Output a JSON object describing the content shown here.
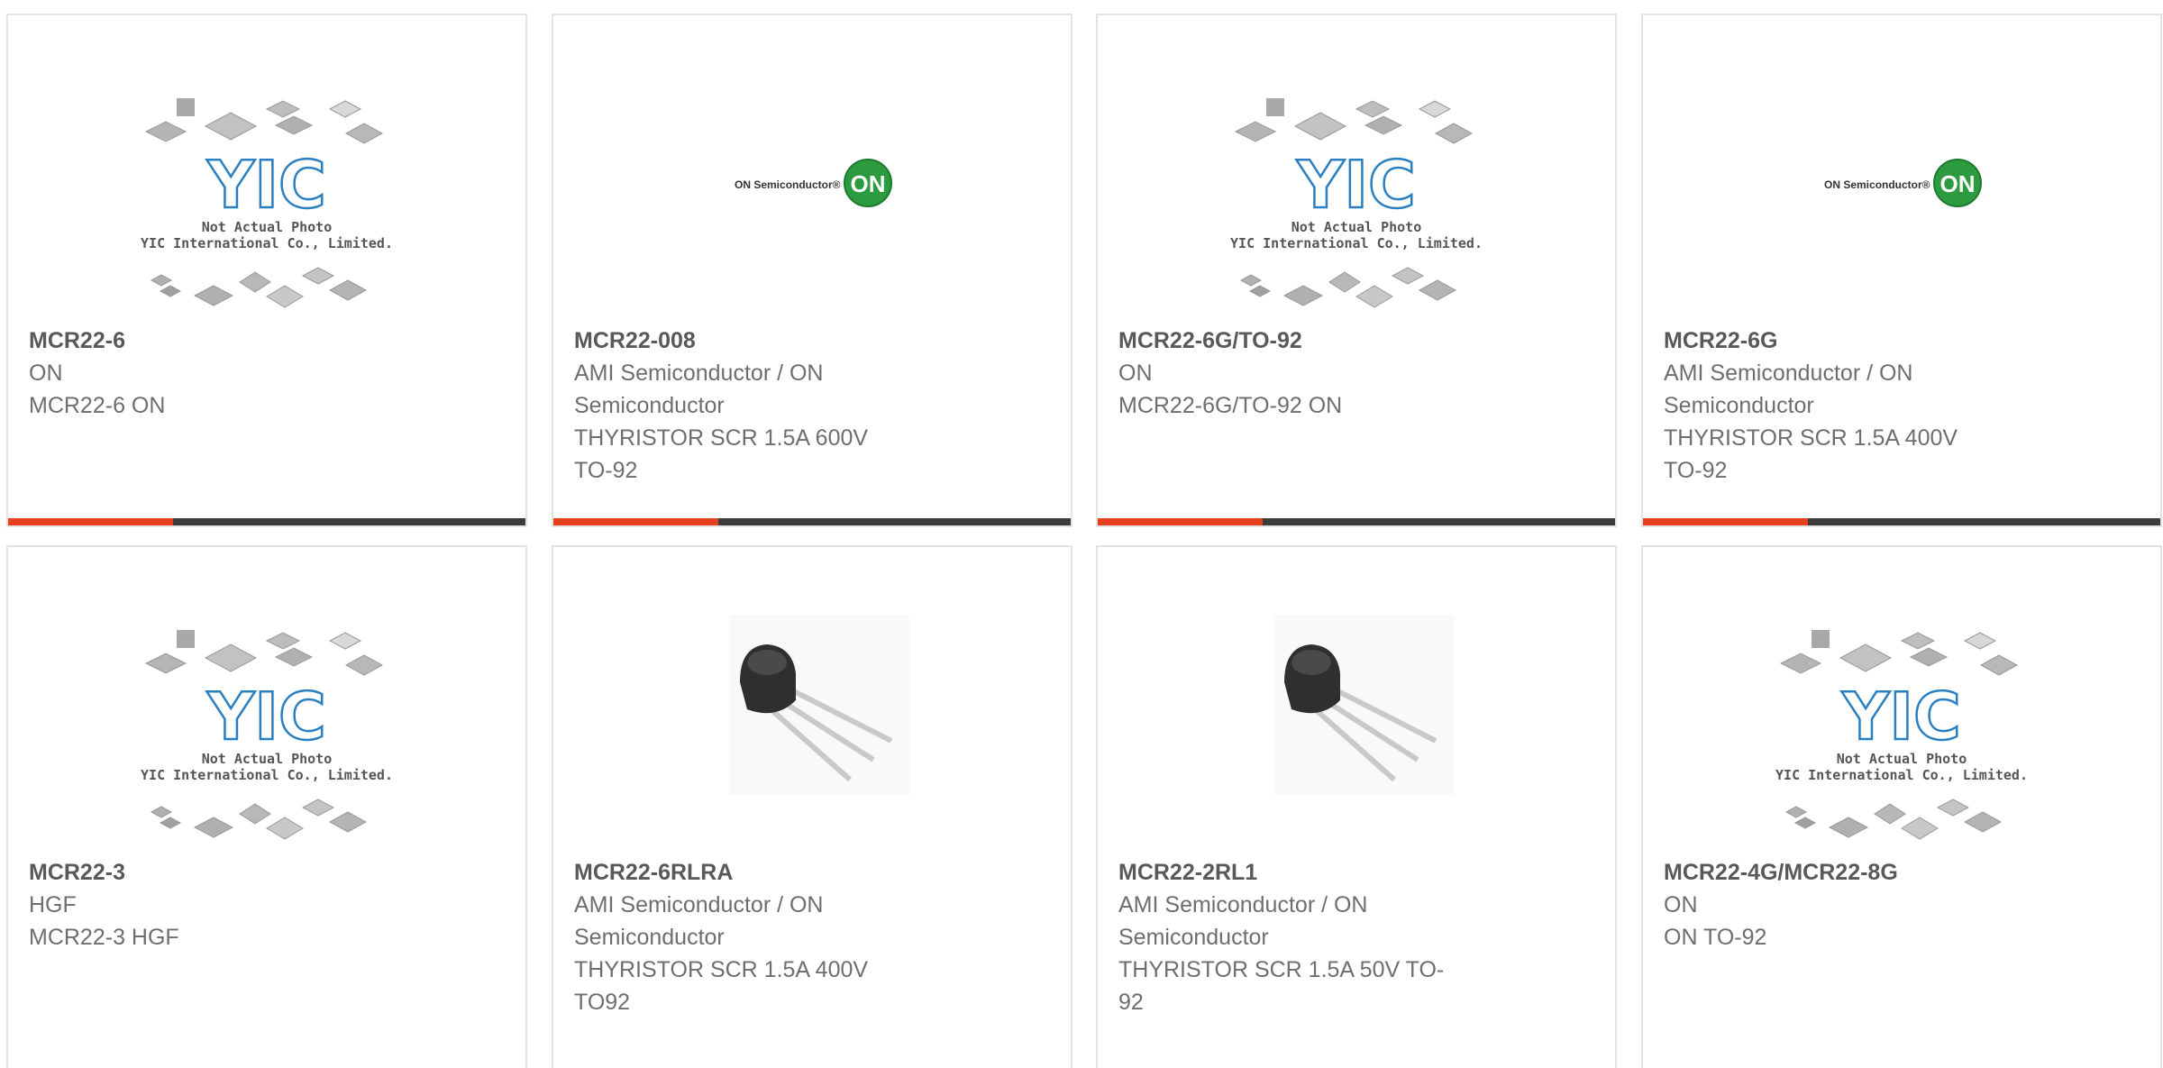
{
  "products": [
    {
      "name": "MCR22-6",
      "lines": [
        "ON",
        "MCR22-6 ON"
      ],
      "image": "yic-placeholder"
    },
    {
      "name": "MCR22-008",
      "lines": [
        "AMI Semiconductor / ON",
        "Semiconductor",
        "THYRISTOR SCR 1.5A 600V",
        "TO-92"
      ],
      "image": "on-semiconductor-logo"
    },
    {
      "name": "MCR22-6G/TO-92",
      "lines": [
        "ON",
        "MCR22-6G/TO-92 ON"
      ],
      "image": "yic-placeholder"
    },
    {
      "name": "MCR22-6G",
      "lines": [
        "AMI Semiconductor / ON",
        "Semiconductor",
        "THYRISTOR SCR 1.5A 400V",
        "TO-92"
      ],
      "image": "on-semiconductor-logo"
    },
    {
      "name": "MCR22-3",
      "lines": [
        "HGF",
        "MCR22-3 HGF"
      ],
      "image": "yic-placeholder"
    },
    {
      "name": "MCR22-6RLRA",
      "lines": [
        "AMI Semiconductor / ON",
        "Semiconductor",
        "THYRISTOR SCR 1.5A 400V",
        "TO92"
      ],
      "image": "to92-transistor-photo"
    },
    {
      "name": "MCR22-2RL1",
      "lines": [
        "AMI Semiconductor / ON",
        "Semiconductor",
        "THYRISTOR SCR 1.5A 50V TO-",
        "92"
      ],
      "image": "to92-transistor-photo"
    },
    {
      "name": "MCR22-4G/MCR22-8G",
      "lines": [
        "ON",
        "ON TO-92"
      ],
      "image": "yic-placeholder"
    }
  ],
  "placeholder": {
    "line1": "Not Actual Photo",
    "line2": "YIC International Co., Limited.",
    "logo": "YIC"
  },
  "on_logo": {
    "wordmark": "ON Semiconductor®",
    "badge": "ON"
  },
  "colors": {
    "accent": "#e8401c",
    "bar": "#3c3c3c",
    "yic_blue": "#2a7fc1",
    "on_green": "#2c9a3e",
    "title": "#595959",
    "text": "#6e6e6e"
  }
}
